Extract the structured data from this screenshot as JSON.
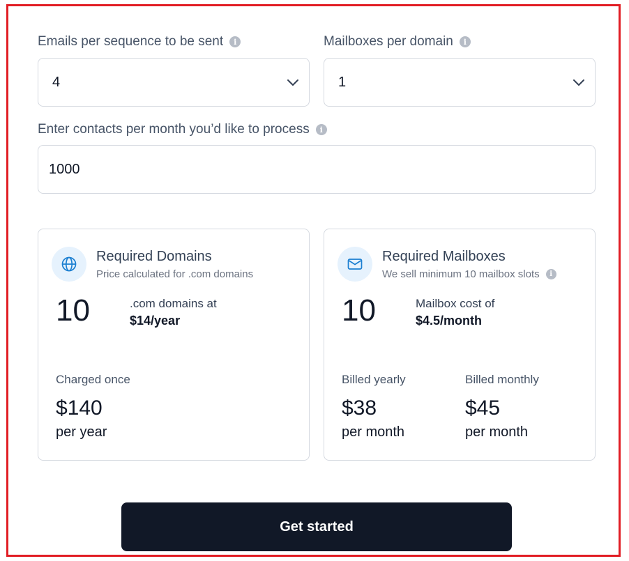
{
  "form": {
    "emails_label": "Emails per sequence to be sent",
    "emails_value": "4",
    "mailboxes_label": "Mailboxes per domain",
    "mailboxes_value": "1",
    "contacts_label": "Enter contacts per month you’d like to process",
    "contacts_value": "1000"
  },
  "domains_card": {
    "title": "Required Domains",
    "subtitle": "Price calculated for .com domains",
    "count": "10",
    "desc_line1": ".com domains at",
    "desc_price": "$14/year",
    "charge_label": "Charged once",
    "charge_price": "$140",
    "charge_period": "per year",
    "icon": "globe-icon"
  },
  "mailboxes_card": {
    "title": "Required Mailboxes",
    "subtitle": "We sell minimum 10 mailbox slots",
    "count": "10",
    "desc_line1": "Mailbox cost of",
    "desc_price": "$4.5/month",
    "yearly_label": "Billed yearly",
    "yearly_price": "$38",
    "yearly_period": "per month",
    "monthly_label": "Billed monthly",
    "monthly_price": "$45",
    "monthly_period": "per month",
    "icon": "envelope-icon"
  },
  "cta": {
    "label": "Get started"
  },
  "colors": {
    "frame": "#e11d24",
    "button_bg": "#111827",
    "icon_bg": "#e6f2fd",
    "icon_stroke": "#1b7fd1"
  }
}
